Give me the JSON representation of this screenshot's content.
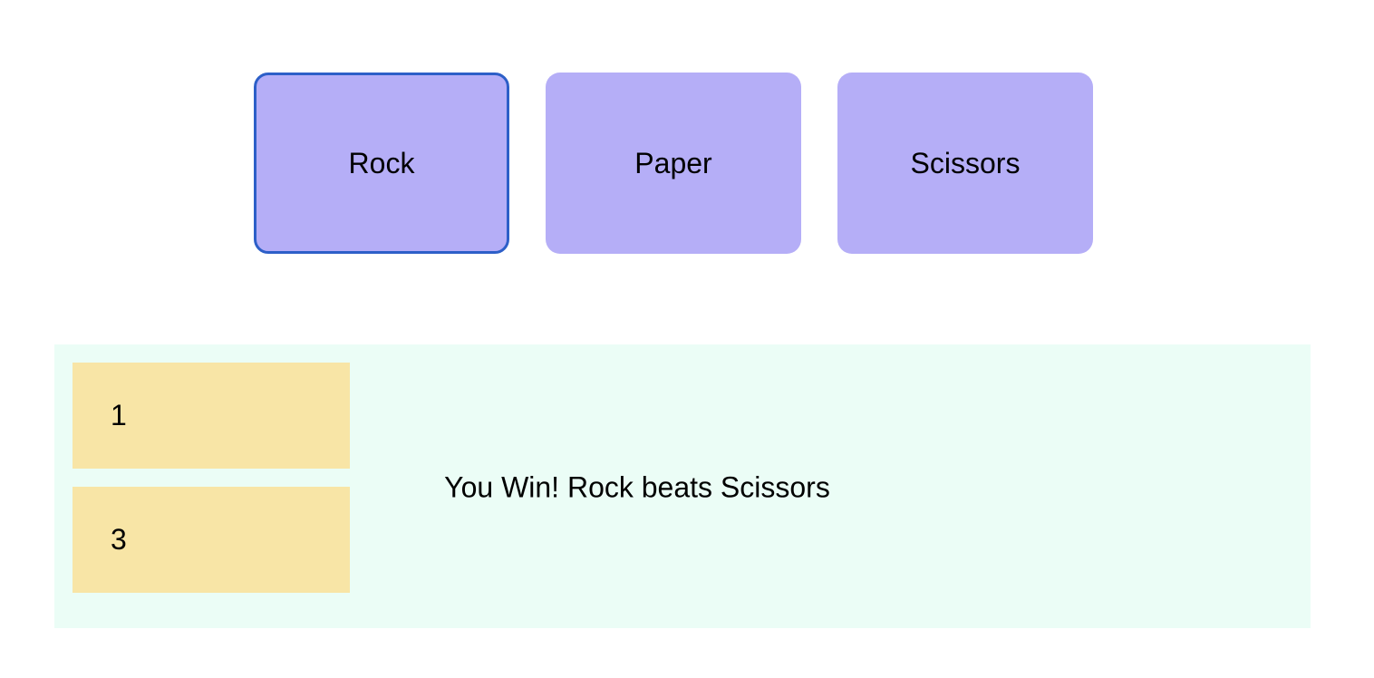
{
  "choices": {
    "rock_label": "Rock",
    "paper_label": "Paper",
    "scissors_label": "Scissors",
    "selected": "Rock"
  },
  "scoreboard": {
    "first_score": "1",
    "second_score": "3"
  },
  "result": {
    "message": "You Win! Rock beats Scissors"
  },
  "colors": {
    "button_background": "#b5aef7",
    "selected_border": "#2d5fc8",
    "panel_background": "#ebfdf6",
    "score_background": "#f8e5a6"
  }
}
